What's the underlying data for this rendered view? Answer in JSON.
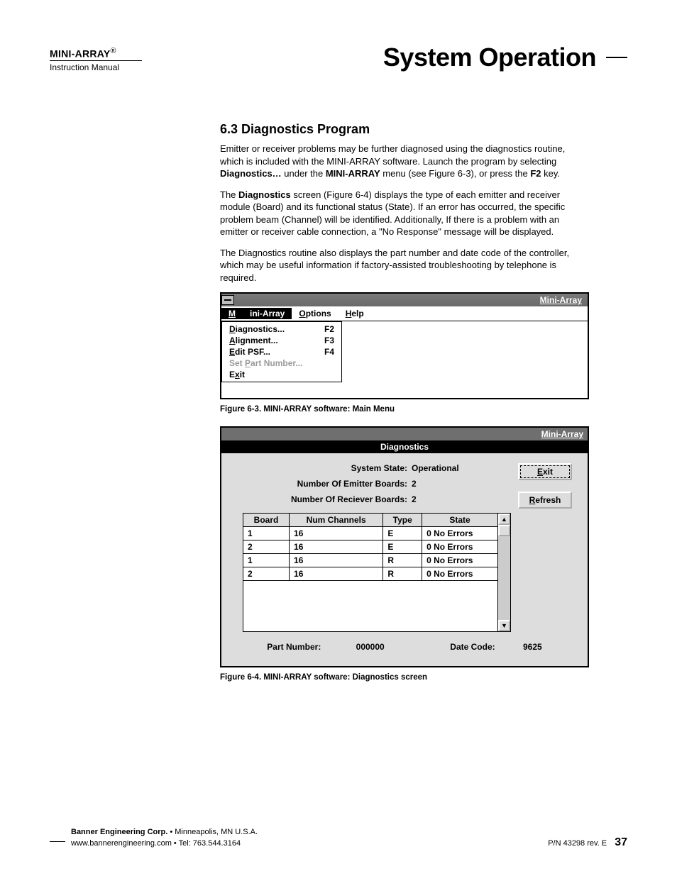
{
  "header": {
    "product": "MINI-ARRAY",
    "regmark": "®",
    "subtitle": "Instruction Manual",
    "page_title": "System Operation"
  },
  "section": {
    "title": "6.3  Diagnostics Program",
    "p1_a": "Emitter or receiver problems may be further diagnosed using the diagnostics routine, which is included with the MINI-ARRAY software. Launch the program by selecting ",
    "p1_b": "Diagnostics…",
    "p1_c": " under the ",
    "p1_d": "MINI-ARRAY",
    "p1_e": " menu (see Figure 6-3), or press the ",
    "p1_f": "F2",
    "p1_g": " key.",
    "p2_a": "The ",
    "p2_b": "Diagnostics",
    "p2_c": " screen (Figure 6-4) displays the type of each emitter and receiver module (Board) and its functional status (State). If an error has occurred, the specific problem beam (Channel) will be identified. Additionally, If there is a problem with an emitter or receiver cable connection, a \"No Response\" message will be displayed.",
    "p3": "The Diagnostics routine also displays the part number and date code of the controller, which may be useful information if factory-assisted troubleshooting by telephone is required."
  },
  "fig63": {
    "titlebar": "Mini-Array",
    "menubar": {
      "m1": "Mini-Array",
      "m2": "Options",
      "m3": "Help"
    },
    "items": [
      {
        "label": "Diagnostics...",
        "key": "F2",
        "disabled": false
      },
      {
        "label": "Alignment...",
        "key": "F3",
        "disabled": false
      },
      {
        "label": "Edit PSF...",
        "key": "F4",
        "disabled": false
      },
      {
        "label": "Set Part Number...",
        "key": "",
        "disabled": true
      },
      {
        "label": "Exit",
        "key": "",
        "disabled": false
      }
    ],
    "caption": "Figure 6-3.  MINI-ARRAY software: Main Menu"
  },
  "fig64": {
    "titlebar": "Mini-Array",
    "subtitle": "Diagnostics",
    "info": {
      "system_state_label": "System State:",
      "system_state_value": "Operational",
      "emitter_label": "Number Of Emitter Boards:",
      "emitter_value": "2",
      "receiver_label": "Number Of Reciever Boards:",
      "receiver_value": "2"
    },
    "buttons": {
      "exit": "Exit",
      "refresh": "Refresh"
    },
    "table": {
      "headers": [
        "Board",
        "Num Channels",
        "Type",
        "State"
      ],
      "rows": [
        [
          "1",
          "16",
          "E",
          "0 No Errors"
        ],
        [
          "2",
          "16",
          "E",
          "0 No Errors"
        ],
        [
          "1",
          "16",
          "R",
          "0 No Errors"
        ],
        [
          "2",
          "16",
          "R",
          "0 No Errors"
        ]
      ]
    },
    "bottom": {
      "pn_label": "Part Number:",
      "pn_value": "000000",
      "dc_label": "Date Code:",
      "dc_value": "9625"
    },
    "caption": "Figure 6-4.  MINI-ARRAY software: Diagnostics screen"
  },
  "footer": {
    "line1_a": "Banner Engineering Corp.",
    "line1_b": " • Minneapolis, MN U.S.A.",
    "line2": "www.bannerengineering.com  •  Tel: 763.544.3164",
    "pn": "P/N 43298 rev. E",
    "page": "37"
  }
}
